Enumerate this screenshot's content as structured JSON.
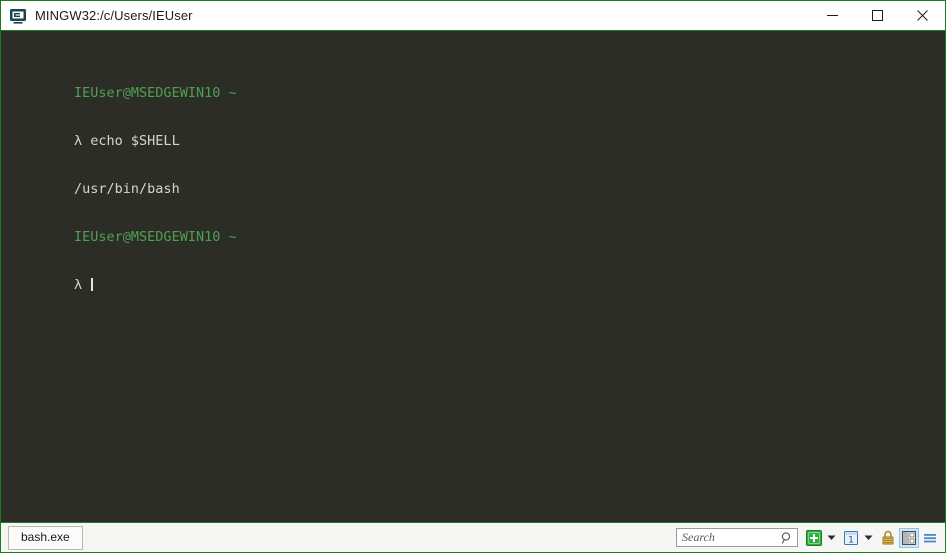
{
  "window": {
    "title": "MINGW32:/c/Users/IEUser",
    "icon": "terminal-app-icon",
    "border_color": "#1e7a1e",
    "titlebar_bg": "#ffffff",
    "controls": {
      "minimize_label": "Minimize",
      "maximize_label": "Maximize",
      "close_label": "Close"
    }
  },
  "terminal": {
    "background_color": "#2d2d28",
    "prompt_color": "#4ea04e",
    "text_color": "#d6d6cc",
    "cursor": "block",
    "lines": [
      {
        "id": "line1",
        "segments": [
          {
            "text": "IEUser@MSEDGEWIN10 ~",
            "color": "green"
          }
        ]
      },
      {
        "id": "line2",
        "segments": [
          {
            "text": "λ echo $SHELL",
            "color": "white"
          }
        ]
      },
      {
        "id": "line3",
        "segments": [
          {
            "text": "/usr/bin/bash",
            "color": "white"
          }
        ]
      },
      {
        "id": "line4",
        "segments": [
          {
            "text": "IEUser@MSEDGEWIN10 ~",
            "color": "green"
          }
        ]
      },
      {
        "id": "line5",
        "segments": [
          {
            "text": "λ ",
            "color": "white"
          }
        ],
        "cursor": true
      }
    ],
    "plain_text": "IEUser@MSEDGEWIN10 ~\nλ echo $SHELL\n/usr/bin/bash\nIEUser@MSEDGEWIN10 ~\nλ "
  },
  "statusbar": {
    "background_color": "#f6f6f4",
    "tab": {
      "label": "bash.exe"
    },
    "search": {
      "placeholder": "Search",
      "value": "",
      "icon": "magnifier-icon"
    },
    "tools": [
      {
        "name": "new-tab-button",
        "icon": "green-plus-icon",
        "label": ""
      },
      {
        "name": "new-tab-dropdown",
        "icon": "chevron-down-icon",
        "label": ""
      },
      {
        "name": "window-number-button",
        "icon": "window-one-icon",
        "label": "1"
      },
      {
        "name": "window-dropdown",
        "icon": "chevron-down-icon",
        "label": ""
      },
      {
        "name": "lock-button",
        "icon": "lock-icon",
        "label": ""
      },
      {
        "name": "split-pane-button",
        "icon": "split-pane-icon",
        "label": "",
        "selected": true
      },
      {
        "name": "menu-button",
        "icon": "hamburger-menu-icon",
        "label": ""
      }
    ]
  }
}
